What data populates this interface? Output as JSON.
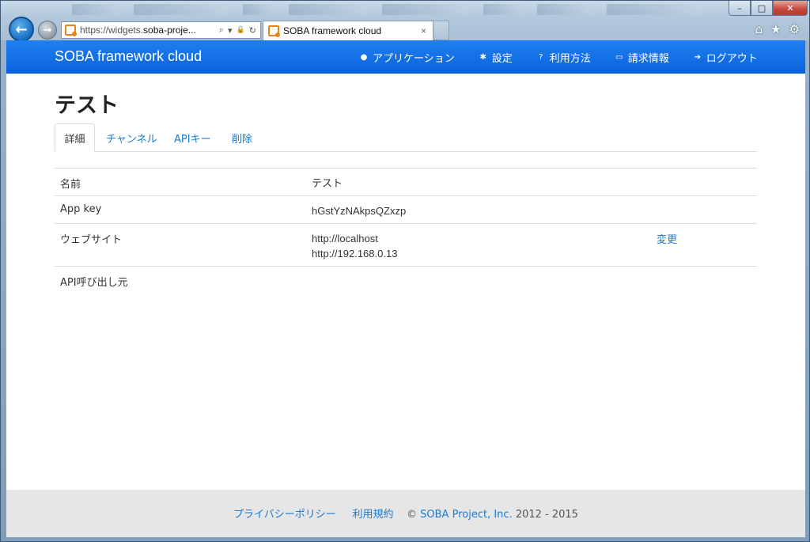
{
  "browser": {
    "address": "https://widgets.soba-proje...",
    "address_prefix": "https://widgets.",
    "address_domain": "soba-proje...",
    "tab_title": "SOBA framework cloud",
    "tab_close": "×",
    "win_min": "–",
    "win_max": "□",
    "win_close": "✕",
    "back": "←",
    "forward": "→",
    "addr_icons": {
      "search": "⌕",
      "dropdown": "▾",
      "lock": "🔒",
      "refresh": "↻"
    },
    "tools": {
      "home": "⌂",
      "favorites": "★",
      "settings": "⚙"
    }
  },
  "navbar": {
    "brand": "SOBA framework cloud",
    "links": [
      {
        "icon": "●",
        "label": "アプリケーション"
      },
      {
        "icon": "✱",
        "label": "設定"
      },
      {
        "icon": "?",
        "label": "利用方法"
      },
      {
        "icon": "▭",
        "label": "請求情報"
      },
      {
        "icon": "➔",
        "label": "ログアウト"
      }
    ]
  },
  "page": {
    "title": "テスト",
    "tabs": [
      "詳細",
      "チャンネル",
      "APIキー",
      "削除"
    ]
  },
  "details": {
    "name_label": "名前",
    "name_value": "テスト",
    "appkey_label": "App key",
    "appkey_value": "hGstYzNAkpsQZxzp",
    "website_label": "ウェブサイト",
    "website_values": [
      "http://localhost",
      "http://192.168.0.13"
    ],
    "website_action": "変更",
    "caller_label": "API呼び出し元"
  },
  "footer": {
    "privacy": "プライバシーポリシー",
    "terms": "利用規約",
    "copyright_symbol": "©",
    "company": "SOBA Project, Inc.",
    "years": "2012 - 2015"
  },
  "colors": {
    "navbar": "#1172e8",
    "link": "#1a7bd0",
    "footer_bg": "#e6e6e6"
  }
}
